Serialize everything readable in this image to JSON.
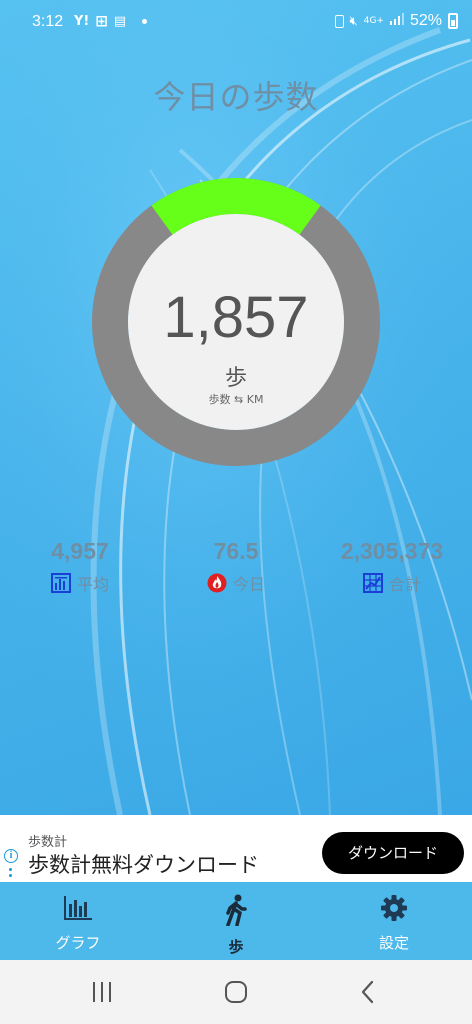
{
  "status_bar": {
    "time": "3:12",
    "left_icons": [
      "yahoo-news-icon",
      "app-notification-icon",
      "news-icon"
    ],
    "network": "4G+",
    "battery": "52%"
  },
  "page": {
    "title": "今日の歩数"
  },
  "gauge": {
    "progress": 0.2,
    "progress_color": "#66ff1a",
    "track_color": "#888888",
    "steps": "1,857",
    "unit": "歩",
    "toggle": "歩数 ⇆ KM"
  },
  "stats": [
    {
      "value": "4,957",
      "label": "平均",
      "icon": "chart-icon",
      "icon_color": "#1a3fd6"
    },
    {
      "value": "76.5",
      "label": "今日",
      "icon": "fire-icon",
      "icon_color": "#e02020"
    },
    {
      "value": "2,305,373",
      "label": "合計",
      "icon": "grid-chart-icon",
      "icon_color": "#1a3fd6"
    }
  ],
  "ad": {
    "sub": "歩数計",
    "main": "歩数計無料ダウンロード",
    "button": "ダウンロード"
  },
  "nav": {
    "items": [
      {
        "label": "グラフ",
        "icon": "bar-chart-icon",
        "active": false
      },
      {
        "label": "歩",
        "icon": "walking-icon",
        "active": true
      },
      {
        "label": "設定",
        "icon": "gear-icon",
        "active": false
      }
    ]
  }
}
